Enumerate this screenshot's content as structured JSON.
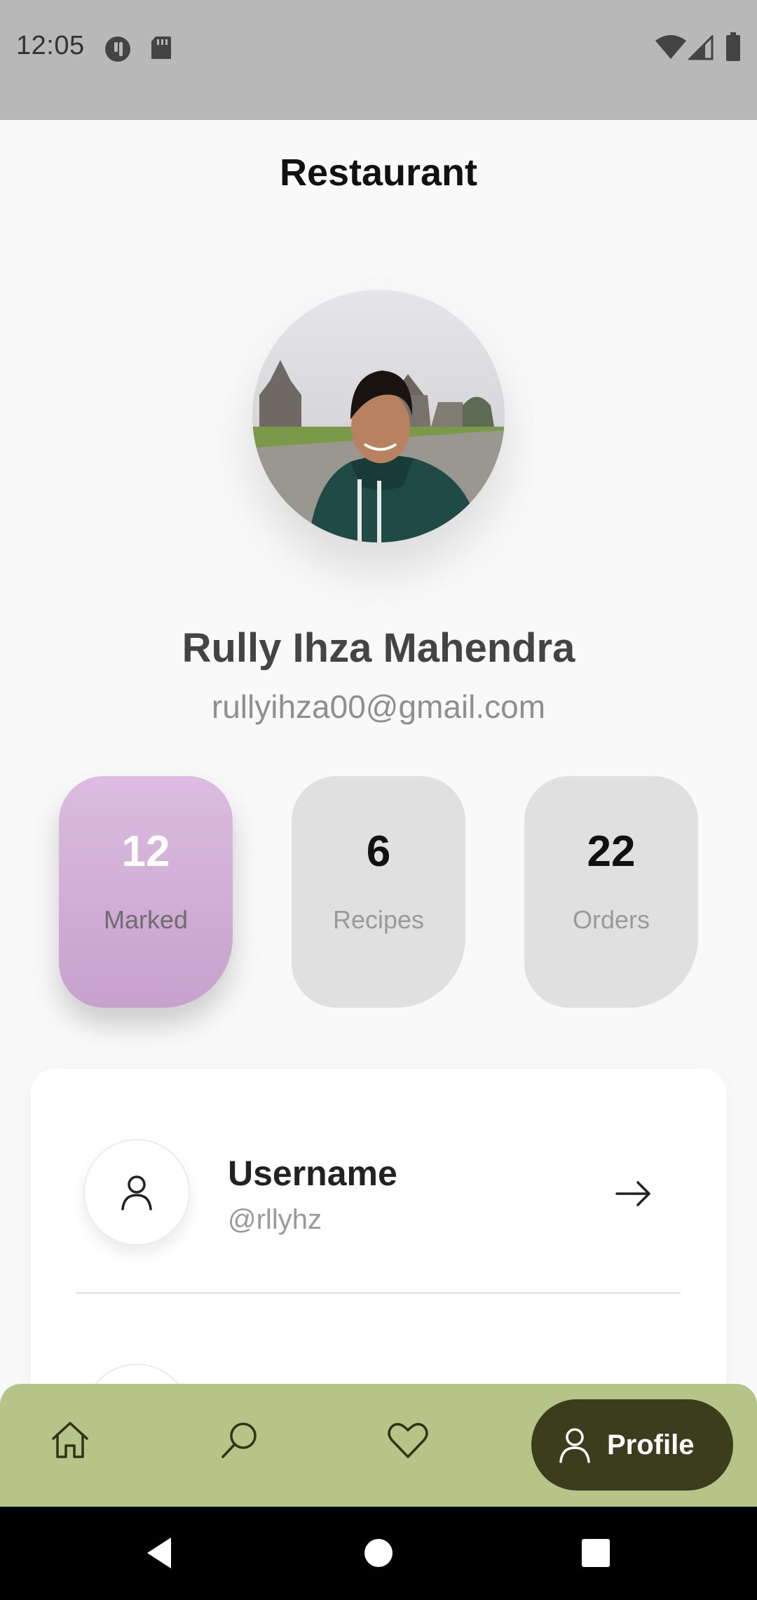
{
  "status_bar": {
    "time": "12:05",
    "icons": [
      "app-notification-icon",
      "sd-card-icon",
      "wifi-icon",
      "cell-signal-icon",
      "battery-icon"
    ]
  },
  "header": {
    "title": "Restaurant"
  },
  "profile": {
    "name": "Rully Ihza Mahendra",
    "email": "rullyihza00@gmail.com"
  },
  "stats": [
    {
      "value": "12",
      "label": "Marked",
      "active": true,
      "color": "#d2b0d7"
    },
    {
      "value": "6",
      "label": "Recipes",
      "active": false,
      "color": "#e0e0e0"
    },
    {
      "value": "22",
      "label": "Orders",
      "active": false,
      "color": "#e0e0e0"
    }
  ],
  "settings": {
    "items": [
      {
        "title": "Username",
        "subtitle": "@rllyhz",
        "icon": "user-icon",
        "action_icon": "arrow-right-icon"
      }
    ]
  },
  "bottom_nav": {
    "items": [
      {
        "icon": "home-icon",
        "label": "",
        "active": false
      },
      {
        "icon": "search-icon",
        "label": "",
        "active": false
      },
      {
        "icon": "heart-icon",
        "label": "",
        "active": false
      },
      {
        "icon": "user-icon",
        "label": "Profile",
        "active": true
      }
    ],
    "background": "#b7c488",
    "active_background": "#3b3d1c"
  },
  "system_nav": {
    "icons": [
      "back-icon",
      "home-circle-icon",
      "recents-icon"
    ]
  }
}
